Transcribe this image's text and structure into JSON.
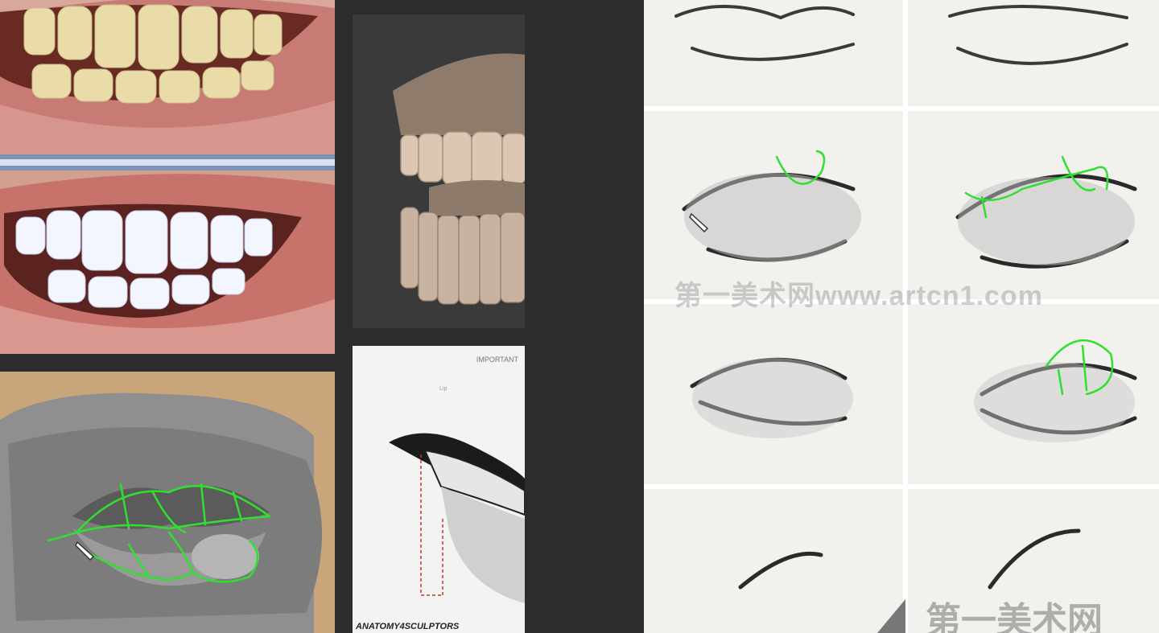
{
  "references": {
    "anatomy_header": "IMPORTANT",
    "anatomy_sub": "Lip",
    "anatomy_logo": "ANATOMY4SCULPTORS"
  },
  "sketch_sheet": {
    "watermark_mid": "第一美术网www.artcn1.com",
    "watermark_bottom": "第一美术网"
  },
  "overlay": {
    "stroke_color": "#2fe02f",
    "tool": "pencil-cursor-icon"
  }
}
